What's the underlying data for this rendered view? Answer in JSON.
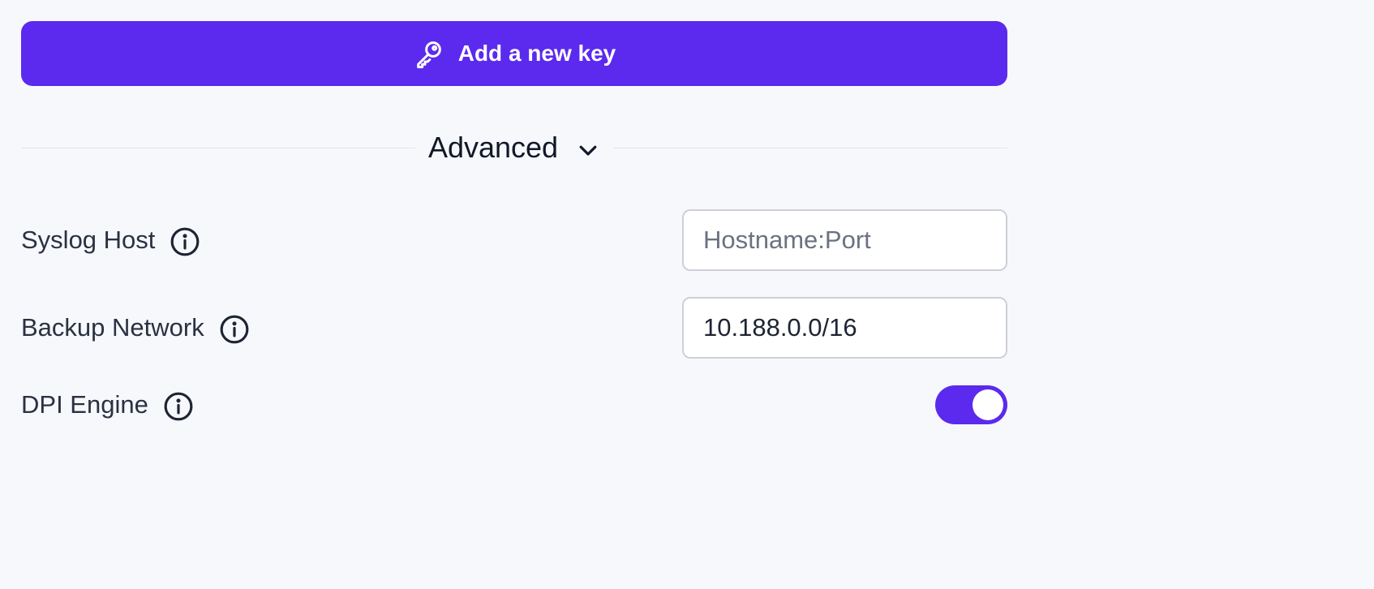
{
  "add_key_button": {
    "label": "Add a new key",
    "icon": "key-icon",
    "background": "#5b2aee"
  },
  "advanced": {
    "label": "Advanced",
    "icon": "chevron-down-icon",
    "expanded": true
  },
  "fields": {
    "syslog_host": {
      "label": "Syslog Host",
      "value": "",
      "placeholder": "Hostname:Port",
      "info_icon": "info-icon"
    },
    "backup_network": {
      "label": "Backup Network",
      "value": "10.188.0.0/16",
      "placeholder": "",
      "info_icon": "info-icon"
    },
    "dpi_engine": {
      "label": "DPI Engine",
      "enabled": true,
      "info_icon": "info-icon"
    }
  },
  "colors": {
    "accent": "#5b2aee",
    "page_background": "#f7f8fc",
    "text": "#1e2433"
  }
}
